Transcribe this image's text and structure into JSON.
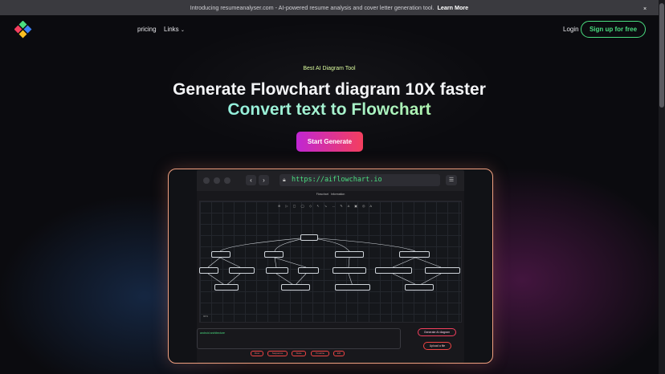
{
  "banner": {
    "text": "Introducing resumeanalyser.com - AI-powered resume analysis and cover letter generation tool.",
    "link": "Learn More",
    "close": "×"
  },
  "header": {
    "nav": [
      "pricing",
      "Links"
    ],
    "login": "Login",
    "signup": "Sign up for free"
  },
  "hero": {
    "eyebrow": "Best AI Diagram Tool",
    "title": "Generate Flowchart diagram 10X faster",
    "subtitle": "Convert text to Flowchart",
    "cta": "Start Generate"
  },
  "preview": {
    "url": "https://aiflowchart.io",
    "tabs": [
      "Flowchart",
      "Information"
    ],
    "zoom": "90%",
    "prompt_text": "android architecture",
    "generate_button": "Generate AI diagram",
    "upload_button": "Upload a file",
    "chips": [
      "Flow",
      "Sequence",
      "State",
      "Timeline",
      "ER"
    ]
  }
}
